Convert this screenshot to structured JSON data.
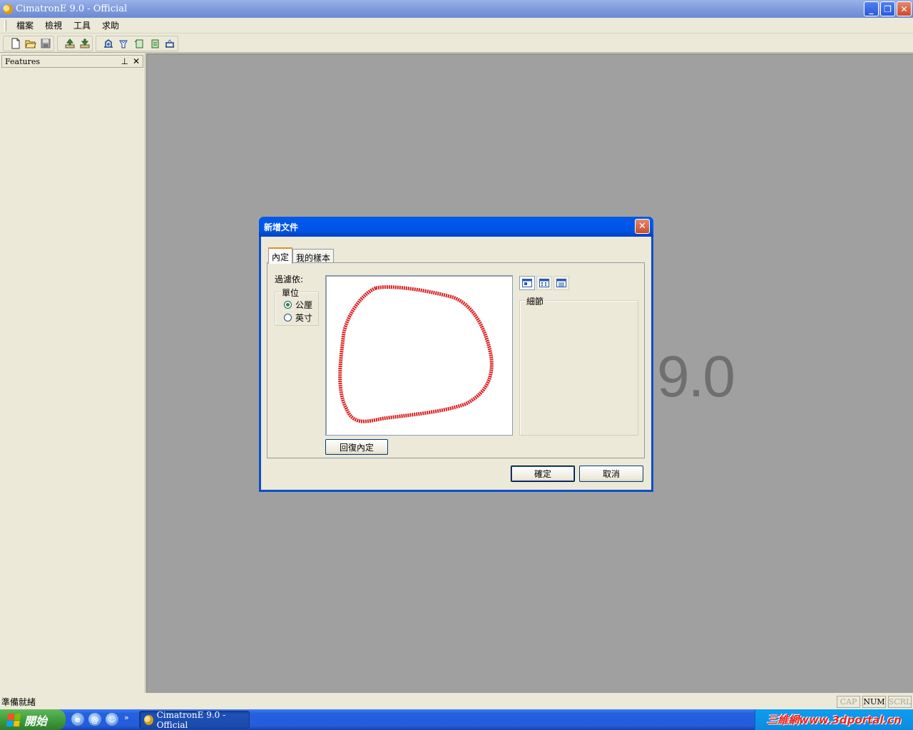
{
  "window": {
    "title": "CimatronE 9.0 - Official"
  },
  "menu": [
    "檔案",
    "檢視",
    "工具",
    "求助"
  ],
  "features_panel": {
    "title": "Features",
    "pin": "⊥",
    "close": "✕"
  },
  "background_logo": {
    "version": "9.0"
  },
  "dialog": {
    "title": "新增文件",
    "tabs": [
      "內定",
      "我的樣本"
    ],
    "filter_label": "過濾依:",
    "units": {
      "legend": "單位",
      "options": [
        "公厘",
        "英寸"
      ],
      "selected": "公厘"
    },
    "restore_label": "回復內定",
    "details_label": "細節",
    "ok_label": "確定",
    "cancel_label": "取消"
  },
  "status": {
    "text": "準備就緒",
    "indicators": [
      {
        "label": "CAP",
        "on": false
      },
      {
        "label": "NUM",
        "on": true
      },
      {
        "label": "SCRL",
        "on": false
      }
    ]
  },
  "taskbar": {
    "start_label": "開始",
    "task_title": "CimatronE 9.0 - Official",
    "watermark": "三維網www.3dportal.cn"
  },
  "colors": {
    "title_blue": "#0054e3",
    "mdi_background": "#a0a0a0",
    "stroke_red": "#d81e1e"
  }
}
